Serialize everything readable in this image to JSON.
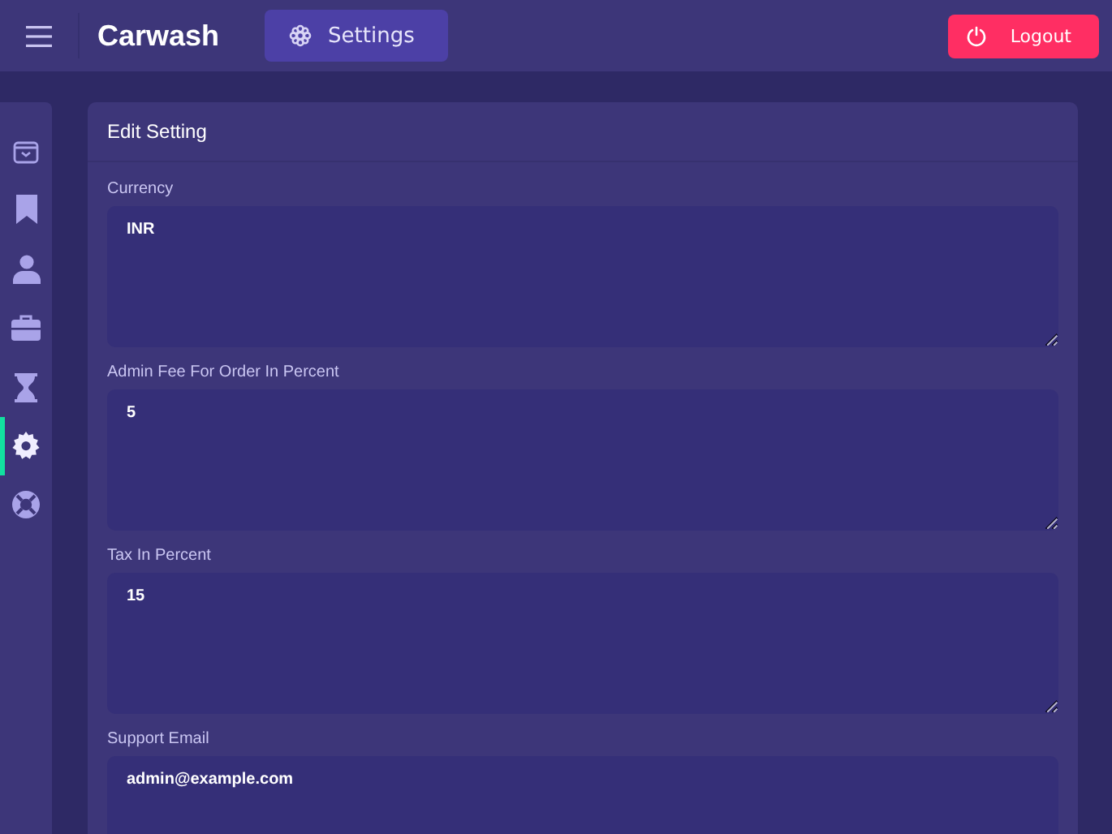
{
  "header": {
    "brand": "Carwash",
    "active_page": "Settings",
    "logout": "Logout"
  },
  "sidebar": {
    "items": [
      {
        "kind": "bag",
        "selected": false
      },
      {
        "kind": "bookmark",
        "selected": false
      },
      {
        "kind": "user",
        "selected": false
      },
      {
        "kind": "briefcase",
        "selected": false
      },
      {
        "kind": "hourglass",
        "selected": false
      },
      {
        "kind": "gear",
        "selected": true
      },
      {
        "kind": "lifebuoy",
        "selected": false
      }
    ]
  },
  "card": {
    "title": "Edit Setting",
    "fields": [
      {
        "label": "Currency",
        "value": "INR"
      },
      {
        "label": "Admin Fee For Order In Percent",
        "value": "5"
      },
      {
        "label": "Tax In Percent",
        "value": "15"
      },
      {
        "label": "Support Email",
        "value": "admin@example.com"
      }
    ]
  }
}
